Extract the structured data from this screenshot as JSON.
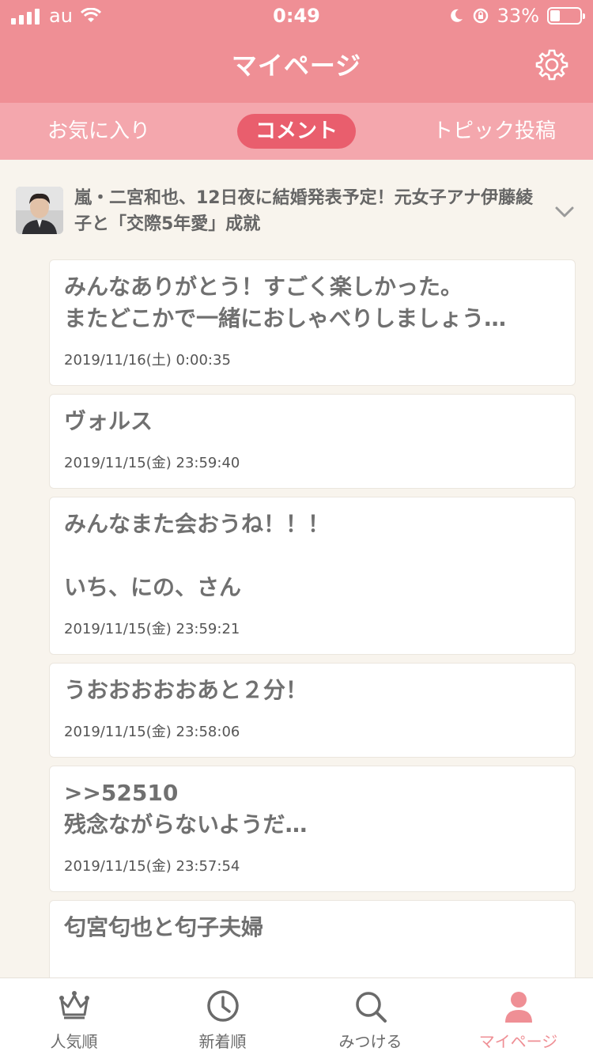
{
  "status_bar": {
    "carrier": "au",
    "time": "0:49",
    "battery": "33%"
  },
  "header": {
    "title": "マイページ"
  },
  "tabs": [
    {
      "label": "お気に入り"
    },
    {
      "label": "コメント"
    },
    {
      "label": "トピック投稿"
    }
  ],
  "topic": {
    "title": "嵐・二宮和也、12日夜に結婚発表予定！元女子アナ伊藤綾子と「交際5年愛」成就"
  },
  "comments": [
    {
      "text": "みんなありがとう！すごく楽しかった。\nまたどこかで一緒におしゃべりしましょう…",
      "date": "2019/11/16(土) 0:00:35"
    },
    {
      "text": "ヴォルス",
      "date": "2019/11/15(金) 23:59:40"
    },
    {
      "text": "みんなまた会おうね！！！\n\nいち、にの、さん",
      "date": "2019/11/15(金) 23:59:21"
    },
    {
      "text": "うおおおおおあと２分！",
      "date": "2019/11/15(金) 23:58:06"
    },
    {
      "text": ">>52510\n残念ながらないようだ…",
      "date": "2019/11/15(金) 23:57:54"
    },
    {
      "text": "匂宮匂也と匂子夫婦",
      "date": ""
    }
  ],
  "tabbar": [
    {
      "label": "人気順",
      "icon": "crown-icon"
    },
    {
      "label": "新着順",
      "icon": "clock-icon"
    },
    {
      "label": "みつける",
      "icon": "search-icon"
    },
    {
      "label": "マイページ",
      "icon": "person-icon"
    }
  ],
  "colors": {
    "accent": "#ef8f95",
    "active_tab": "#e95e6d",
    "background": "#f8f4ed"
  }
}
